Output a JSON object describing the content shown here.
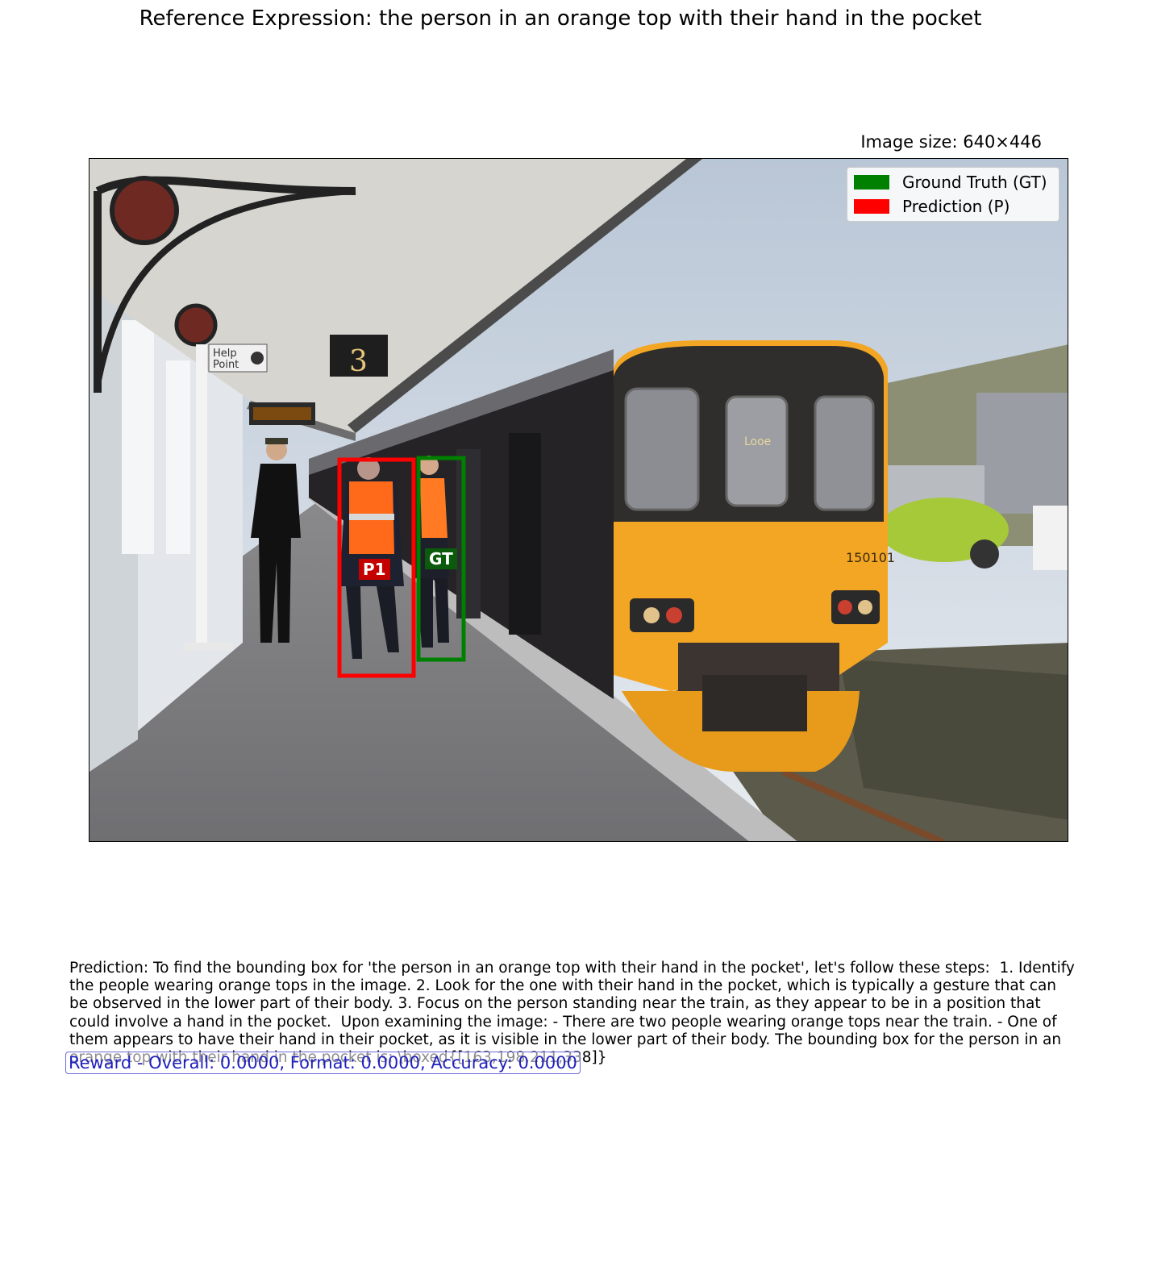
{
  "title": "Reference Expression: the person in an orange top with their hand in the pocket",
  "image_size_label": "Image size: 640×446",
  "legend": {
    "gt_label": "Ground Truth (GT)",
    "pred_label": "Prediction (P)",
    "gt_color": "#008000",
    "pred_color": "#ff0000"
  },
  "boxes": {
    "gt_tag": "GT",
    "pred_tag": "P1"
  },
  "photo_text": {
    "help_point": "Help",
    "help_point_2": "Point",
    "platform_number": "3",
    "destination": "Looe",
    "unit_number": "150101"
  },
  "prediction_text": "Prediction: To find the bounding box for 'the person in an orange top with their hand in the pocket', let's follow these steps:  1. Identify the people wearing orange tops in the image. 2. Look for the one with their hand in the pocket, which is typically a gesture that can be observed in the lower part of their body. 3. Focus on the person standing near the train, as they appear to be in a position that could involve a hand in the pocket.  Upon examining the image: - There are two people wearing orange tops near the train. - One of them appears to have their hand in their pocket, as it is visible in the lower part of their body. The bounding box for the person in an orange top with their hand in the pocket is: \\boxed{[163,198,211,338]}",
  "reward_text": "Reward - Overall: 0.0000, Format: 0.0000, Accuracy: 0.0000"
}
